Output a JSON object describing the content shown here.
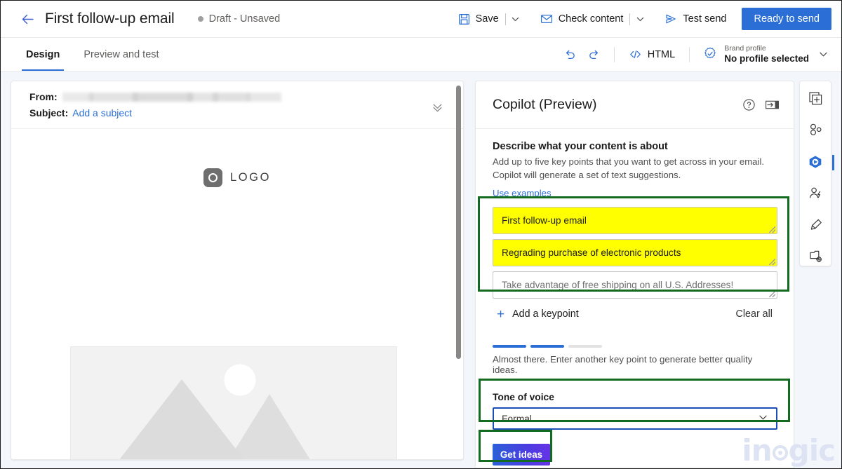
{
  "header": {
    "back_icon": "arrow-left-icon",
    "title": "First follow-up email",
    "status": "Draft - Unsaved",
    "save_label": "Save",
    "check_content_label": "Check content",
    "test_send_label": "Test send",
    "ready_to_send_label": "Ready to send",
    "primary_color": "#2b6fd6"
  },
  "tabbar": {
    "tabs": [
      {
        "label": "Design",
        "active": true
      },
      {
        "label": "Preview and test",
        "active": false
      }
    ],
    "undo_icon": "undo-icon",
    "redo_icon": "redo-icon",
    "html_label": "HTML",
    "brand_profile_label": "Brand profile",
    "brand_profile_value": "No profile selected"
  },
  "email": {
    "from_label": "From:",
    "from_value": "",
    "subject_label": "Subject:",
    "subject_link": "Add a subject",
    "logo_text": "LOGO",
    "expand_icon": "chevron-double-down-icon"
  },
  "copilot": {
    "title": "Copilot (Preview)",
    "help_icon": "question-circle-icon",
    "collapse_icon": "panel-collapse-icon",
    "section_title": "Describe what your content is about",
    "section_desc": "Add up to five key points that you want to get across in your email. Copilot will generate a set of text suggestions.",
    "use_examples_label": "Use examples",
    "keypoints": [
      {
        "value": "First follow-up email",
        "placeholder": "",
        "highlighted": true
      },
      {
        "value": "Regrading purchase of electronic products",
        "placeholder": "",
        "highlighted": true
      },
      {
        "value": "",
        "placeholder": "Take advantage of free shipping on all U.S. Addresses!",
        "highlighted": false
      }
    ],
    "add_keypoint_label": "Add a keypoint",
    "clear_all_label": "Clear all",
    "progress_filled": 2,
    "progress_total": 3,
    "progress_hint": "Almost there. Enter another key point to generate better quality ideas.",
    "tone_label": "Tone of voice",
    "tone_value": "Formal",
    "tone_options": [
      "Formal"
    ],
    "get_ideas_label": "Get ideas",
    "annotation_color": "#136b21",
    "highlight_color": "#ffff00"
  },
  "rail": {
    "items": [
      {
        "icon": "add-section-icon",
        "active": false
      },
      {
        "icon": "layout-elements-icon",
        "active": false
      },
      {
        "icon": "copilot-icon",
        "active": true
      },
      {
        "icon": "personalization-icon",
        "active": false
      },
      {
        "icon": "styles-brush-icon",
        "active": false
      },
      {
        "icon": "content-settings-icon",
        "active": false
      }
    ]
  },
  "watermark": {
    "text_left": "in",
    "text_right": "gic"
  }
}
